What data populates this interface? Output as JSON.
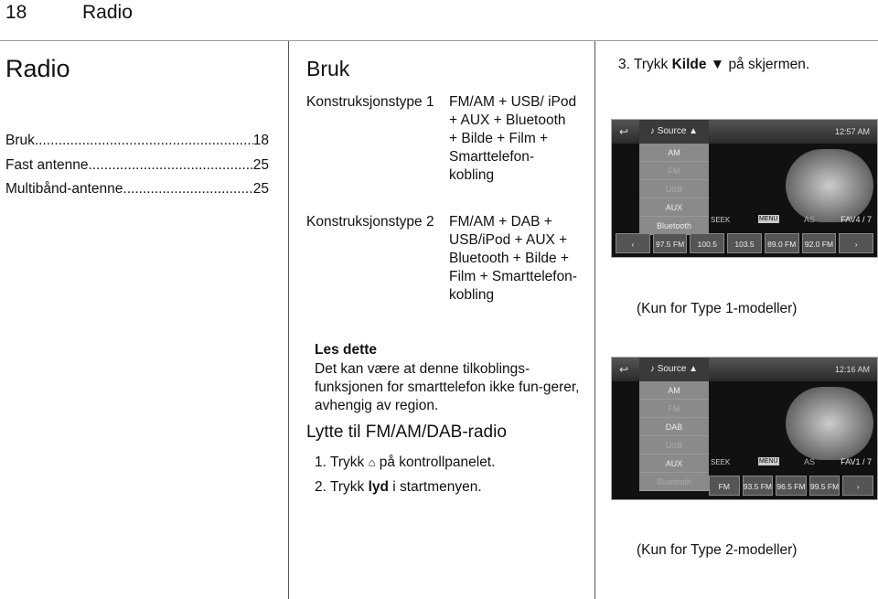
{
  "header": {
    "page_number": "18",
    "chapter": "Radio"
  },
  "section_title": "Radio",
  "toc": [
    {
      "label": "Bruk",
      "page": "18"
    },
    {
      "label": "Fast antenne",
      "page": "25"
    },
    {
      "label": "Multibånd-antenne",
      "page": "25"
    }
  ],
  "bruk": {
    "title": "Bruk",
    "rows": [
      {
        "label": "Konstruksjonstype 1",
        "value": "FM/AM + USB/ iPod + AUX + Bluetooth + Bilde + Film + Smarttelefon-kobling"
      },
      {
        "label": "Konstruksjonstype 2",
        "value": "FM/AM + DAB + USB/iPod + AUX + Bluetooth + Bilde + Film + Smarttelefon-kobling"
      }
    ]
  },
  "note": {
    "title": "Les dette",
    "body": "Det kan være at denne tilkoblings-funksjonen for smarttelefon ikke fun-gerer, avhengig av region."
  },
  "listen": {
    "title": "Lytte til FM/AM/DAB-radio",
    "step1_pre": "1. Trykk",
    "step1_post": "på kontrollpanelet.",
    "step2_pre": "2. Trykk",
    "step2_bold": "lyd",
    "step2_post": "i startmenyen.",
    "step3_pre": "3. Trykk",
    "step3_bold": "Kilde ▼",
    "step3_post": "på skjermen."
  },
  "screen1": {
    "source": "♪ Source ▲",
    "time": "12:57 AM",
    "menu": [
      "AM",
      "FM",
      "USB",
      "AUX",
      "Bluetooth"
    ],
    "seek": "SEEK",
    "menu_btn": "MENU",
    "as": "AS",
    "fav": "FAV4 / 7",
    "presets": [
      "97.5 FM",
      "100.5 FM",
      "103.5 FM",
      "89.0 FM",
      "92.0 FM"
    ],
    "caption": "(Kun for Type 1-modeller)"
  },
  "screen2": {
    "source": "♪ Source ▲",
    "time": "12:16 AM",
    "menu": [
      "AM",
      "FM",
      "DAB",
      "USB",
      "AUX",
      "Bluetooth"
    ],
    "seek": "SEEK",
    "menu_btn": "MENU",
    "as": "AS",
    "fav": "FAV1 / 7",
    "presets": [
      "FM",
      "93.5 FM",
      "96.5 FM",
      "99.5 FM"
    ],
    "caption": "(Kun for Type 2-modeller)"
  }
}
